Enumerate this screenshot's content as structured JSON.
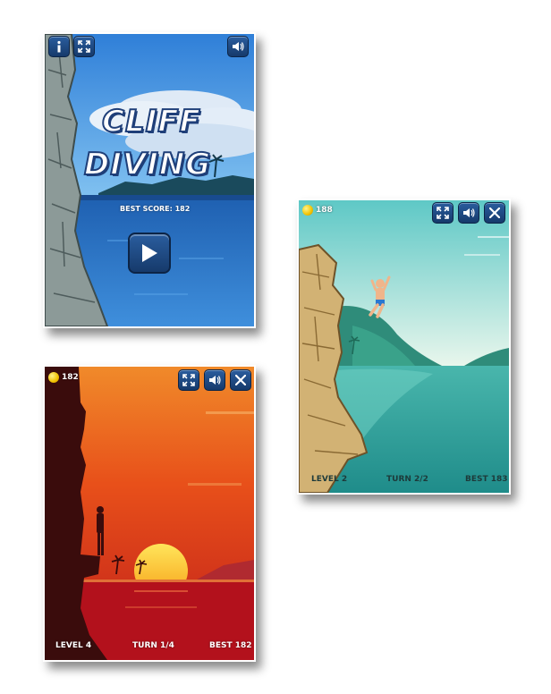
{
  "screen1": {
    "title_line1": "CLIFF",
    "title_line2": "DIVING",
    "best_score": "BEST SCORE: 182",
    "buttons": [
      "info-icon",
      "fullscreen-icon",
      "sound-icon",
      "play-icon"
    ]
  },
  "screen2": {
    "coins": "188",
    "level": "LEVEL 2",
    "turn": "TURN 2/2",
    "best": "BEST 183",
    "buttons": [
      "fullscreen-icon",
      "sound-icon",
      "close-icon"
    ]
  },
  "screen3": {
    "coins": "182",
    "level": "LEVEL 4",
    "turn": "TURN 1/4",
    "best": "BEST 182",
    "buttons": [
      "fullscreen-icon",
      "sound-icon",
      "close-icon"
    ]
  },
  "colors": {
    "button_blue": "#1f4a82",
    "sky_blue": "#3a8ee0",
    "sunset_orange": "#ee6a1a",
    "sea_teal": "#2aa89a"
  }
}
